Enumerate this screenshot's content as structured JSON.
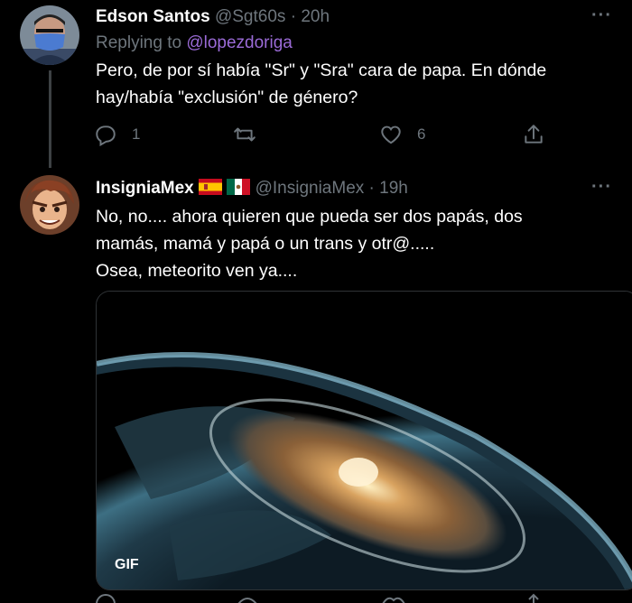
{
  "tweets": [
    {
      "author": {
        "name": "Edson Santos",
        "handle": "@Sgt60s",
        "avatar_icon": "masked-person-avatar"
      },
      "separator": "·",
      "time": "20h",
      "more": "···",
      "replying": {
        "prefix": "Replying to",
        "mention": "@lopezdoriga"
      },
      "lines": [
        "Pero, de por sí había \"Sr\" y \"Sra\" cara de papa. En dónde",
        "hay/había \"exclusión\" de género?"
      ],
      "stats": {
        "replies": "1",
        "retweets": "",
        "likes": "6"
      }
    },
    {
      "author": {
        "name": "InsigniaMex",
        "handle": "@InsigniaMex",
        "flags": [
          "spain-flag-icon",
          "mexico-flag-icon"
        ],
        "avatar_icon": "cartoon-hero-avatar"
      },
      "separator": "·",
      "time": "19h",
      "more": "···",
      "lines": [
        "No, no.... ahora quieren que pueda ser dos papás, dos",
        "mamás, mamá y papá o un trans y otr@.....",
        "Osea, meteorito ven ya...."
      ],
      "media": {
        "badge": "GIF",
        "description_icon": "meteor-impact-earth-gif"
      }
    }
  ],
  "colors": {
    "background": "#000000",
    "text": "#ffffff",
    "muted": "#6e767d",
    "mention": "#9b6bd7",
    "border": "#2f3336"
  }
}
